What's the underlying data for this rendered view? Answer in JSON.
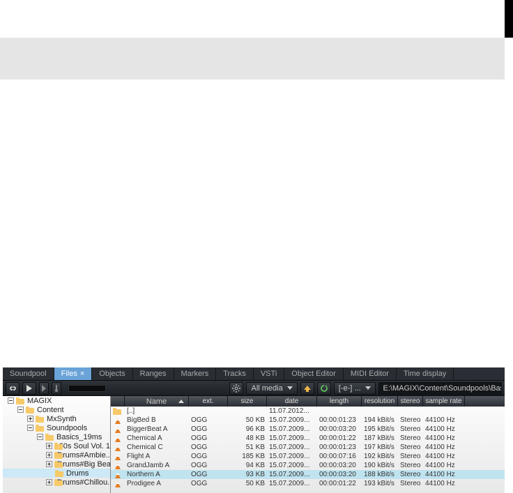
{
  "tabs": [
    {
      "id": "soundpool",
      "label": "Soundpool"
    },
    {
      "id": "files",
      "label": "Files",
      "active": true,
      "closable": true
    },
    {
      "id": "objects",
      "label": "Objects"
    },
    {
      "id": "ranges",
      "label": "Ranges"
    },
    {
      "id": "markers",
      "label": "Markers"
    },
    {
      "id": "tracks",
      "label": "Tracks"
    },
    {
      "id": "vsti",
      "label": "VSTi"
    },
    {
      "id": "objecteditor",
      "label": "Object Editor"
    },
    {
      "id": "midieditor",
      "label": "MIDI Editor"
    },
    {
      "id": "timedisplay",
      "label": "Time display"
    }
  ],
  "toolbar": {
    "media_filter": "All media",
    "drive": "[-e-] ...",
    "path": "E:\\MAGIX\\Content\\Soundpools\\Bas"
  },
  "tree": [
    {
      "indent": 0,
      "exp": "-",
      "label": "MAGIX"
    },
    {
      "indent": 1,
      "exp": "-",
      "label": "Content"
    },
    {
      "indent": 2,
      "exp": "+",
      "label": "MxSynth"
    },
    {
      "indent": 2,
      "exp": "-",
      "label": "Soundpools"
    },
    {
      "indent": 3,
      "exp": "-",
      "label": "Basics_19ms"
    },
    {
      "indent": 4,
      "exp": "+",
      "label": "60s Soul Vol. 1"
    },
    {
      "indent": 4,
      "exp": "+",
      "label": "Drums#Ambie..."
    },
    {
      "indent": 4,
      "exp": "+",
      "label": "Drums#Big Bea..."
    },
    {
      "indent": 4,
      "exp": "",
      "label": "Drums",
      "sel": true
    },
    {
      "indent": 4,
      "exp": "+",
      "label": "Drums#Chillou..."
    }
  ],
  "columns": {
    "name": "Name",
    "ext": "ext.",
    "size": "size",
    "date": "date",
    "length": "length",
    "resolution": "resolution",
    "stereo": "stereo",
    "rate": "sample rate"
  },
  "files": [
    {
      "icon": "up",
      "name": "[..]",
      "ext": "",
      "size": "",
      "date": "11.07.2012...",
      "length": "",
      "res": "",
      "stereo": "",
      "rate": ""
    },
    {
      "icon": "media",
      "name": "BigBed B",
      "ext": "OGG",
      "size": "50 KB",
      "date": "15.07.2009...",
      "length": "00:00:01:23",
      "res": "194 kBit/s",
      "stereo": "Stereo",
      "rate": "44100 Hz"
    },
    {
      "icon": "media",
      "name": "BiggerBeat A",
      "ext": "OGG",
      "size": "96 KB",
      "date": "15.07.2009...",
      "length": "00:00:03:20",
      "res": "195 kBit/s",
      "stereo": "Stereo",
      "rate": "44100 Hz"
    },
    {
      "icon": "media",
      "name": "Chemical A",
      "ext": "OGG",
      "size": "48 KB",
      "date": "15.07.2009...",
      "length": "00:00:01:22",
      "res": "187 kBit/s",
      "stereo": "Stereo",
      "rate": "44100 Hz"
    },
    {
      "icon": "media",
      "name": "Chemical C",
      "ext": "OGG",
      "size": "51 KB",
      "date": "15.07.2009...",
      "length": "00:00:01:23",
      "res": "197 kBit/s",
      "stereo": "Stereo",
      "rate": "44100 Hz"
    },
    {
      "icon": "media",
      "name": "Flight A",
      "ext": "OGG",
      "size": "185 KB",
      "date": "15.07.2009...",
      "length": "00:00:07:16",
      "res": "192 kBit/s",
      "stereo": "Stereo",
      "rate": "44100 Hz"
    },
    {
      "icon": "media",
      "name": "GrandJamb A",
      "ext": "OGG",
      "size": "94 KB",
      "date": "15.07.2009...",
      "length": "00:00:03:20",
      "res": "190 kBit/s",
      "stereo": "Stereo",
      "rate": "44100 Hz"
    },
    {
      "icon": "media",
      "name": "Northern A",
      "ext": "OGG",
      "size": "93 KB",
      "date": "15.07.2009...",
      "length": "00:00:03:20",
      "res": "188 kBit/s",
      "stereo": "Stereo",
      "rate": "44100 Hz",
      "sel": true
    },
    {
      "icon": "media",
      "name": "Prodigee A",
      "ext": "OGG",
      "size": "50 KB",
      "date": "15.07.2009...",
      "length": "00:00:01:22",
      "res": "193 kBit/s",
      "stereo": "Stereo",
      "rate": "44100 Hz"
    }
  ]
}
